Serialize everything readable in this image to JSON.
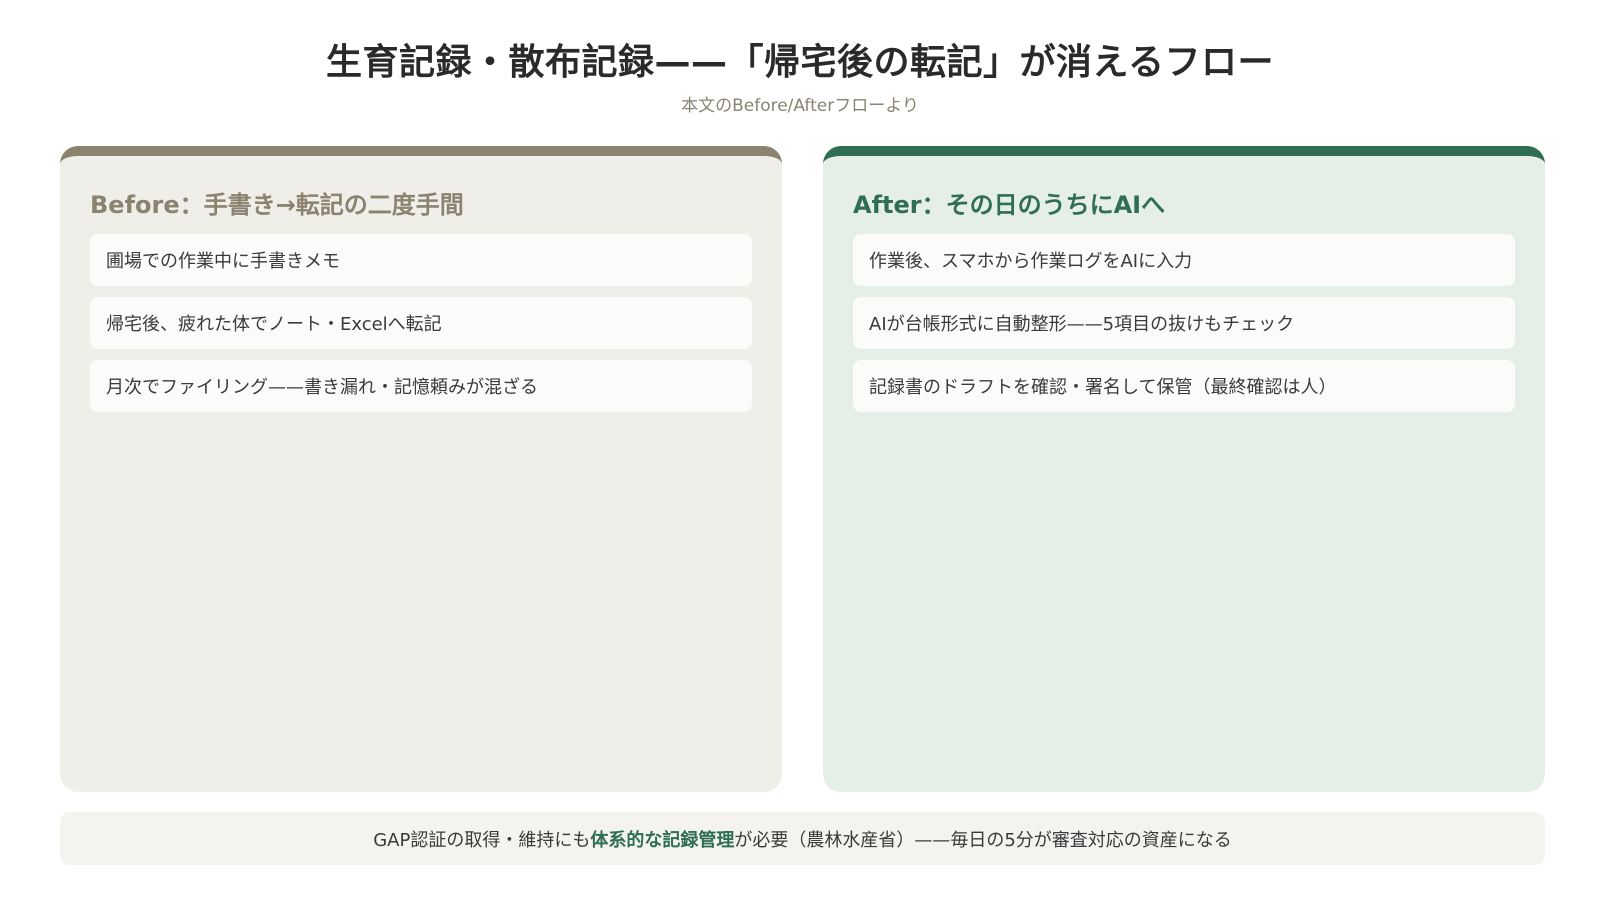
{
  "header": {
    "title": "生育記録・散布記録——「帰宅後の転記」が消えるフロー",
    "subtitle": "本文のBefore/Afterフローより"
  },
  "before": {
    "heading": "Before：手書き→転記の二度手間",
    "steps": [
      "圃場での作業中に手書きメモ",
      "帰宅後、疲れた体でノート・Excelへ転記",
      "月次でファイリング——書き漏れ・記憶頼みが混ざる"
    ]
  },
  "after": {
    "heading": "After：その日のうちにAIへ",
    "steps": [
      "作業後、スマホから作業ログをAIに入力",
      "AIが台帳形式に自動整形——5項目の抜けもチェック",
      "記録書のドラフトを確認・署名して保管（最終確認は人）"
    ]
  },
  "footer": {
    "text_before": "GAP認証の取得・維持にも",
    "text_emphasis": "体系的な記録管理",
    "text_after": "が必要（農林水産省）——毎日の5分が審査対応の資産になる"
  },
  "colors": {
    "before_accent": "#8b8270",
    "after_accent": "#2f6e54",
    "before_panel_bg": "#efeee9",
    "after_panel_bg": "#e6eee8"
  }
}
